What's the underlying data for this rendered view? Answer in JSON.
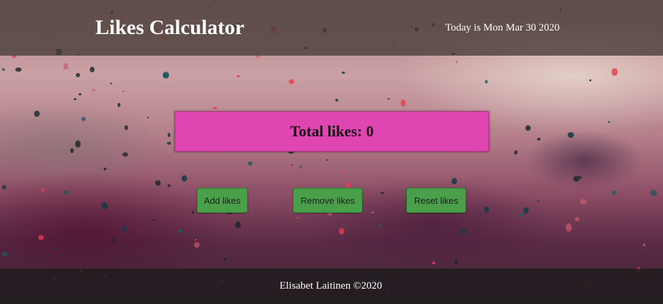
{
  "header": {
    "title": "Likes Calculator",
    "date_text": "Today is Mon Mar 30 2020"
  },
  "counter": {
    "label": "Total likes:",
    "value": "0"
  },
  "buttons": {
    "add": "Add likes",
    "remove": "Remove likes",
    "reset": "Reset likes"
  },
  "footer": {
    "text": "Elisabet Laitinen ©2020"
  },
  "colors": {
    "header_bg": "#463c37",
    "counter_bg": "#e046b2",
    "button_bg": "#4aa04a",
    "footer_bg": "#1e1c1e"
  }
}
